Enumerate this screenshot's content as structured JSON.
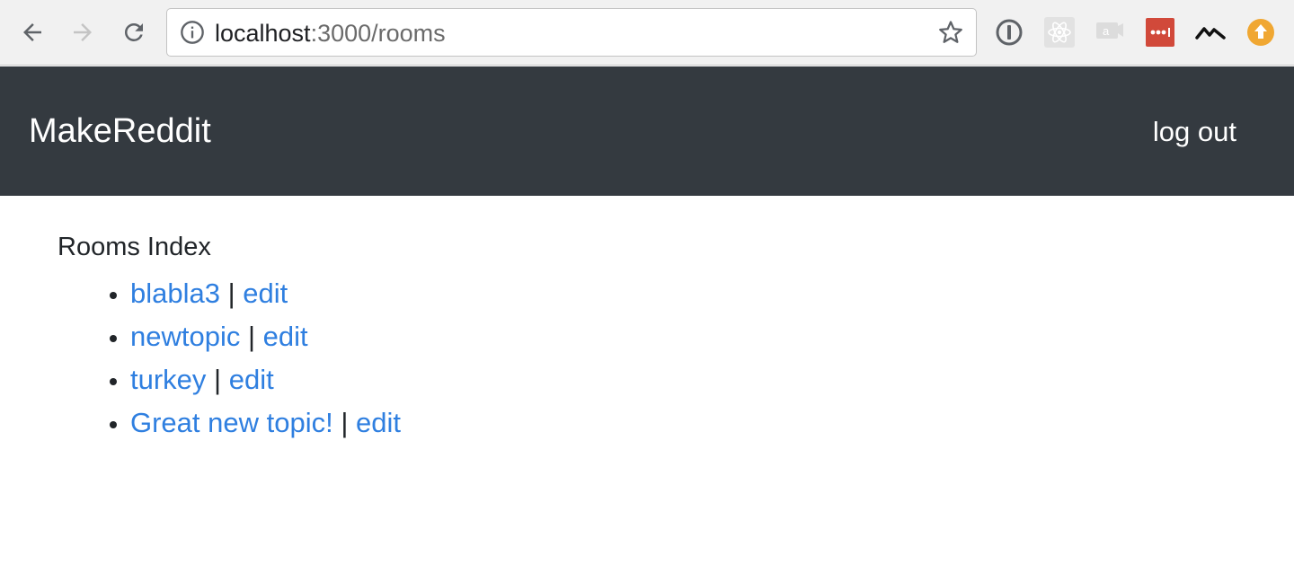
{
  "browser": {
    "url_host": "localhost",
    "url_rest": ":3000/rooms",
    "extensions": [
      "onepassword-icon",
      "react-devtools-icon",
      "chat-extension-icon",
      "lastpass-icon",
      "feedly-icon",
      "upload-icon"
    ]
  },
  "navbar": {
    "brand": "MakeReddit",
    "logout_label": "log out",
    "background": "#343a40"
  },
  "main": {
    "heading": "Rooms Index",
    "rooms": [
      {
        "name": "blabla3",
        "separator": "|",
        "edit_label": "edit"
      },
      {
        "name": "newtopic",
        "separator": "|",
        "edit_label": "edit"
      },
      {
        "name": "turkey",
        "separator": "|",
        "edit_label": "edit"
      },
      {
        "name": "Great new topic!",
        "separator": "|",
        "edit_label": "edit"
      }
    ],
    "link_color": "#2f7fe0"
  }
}
